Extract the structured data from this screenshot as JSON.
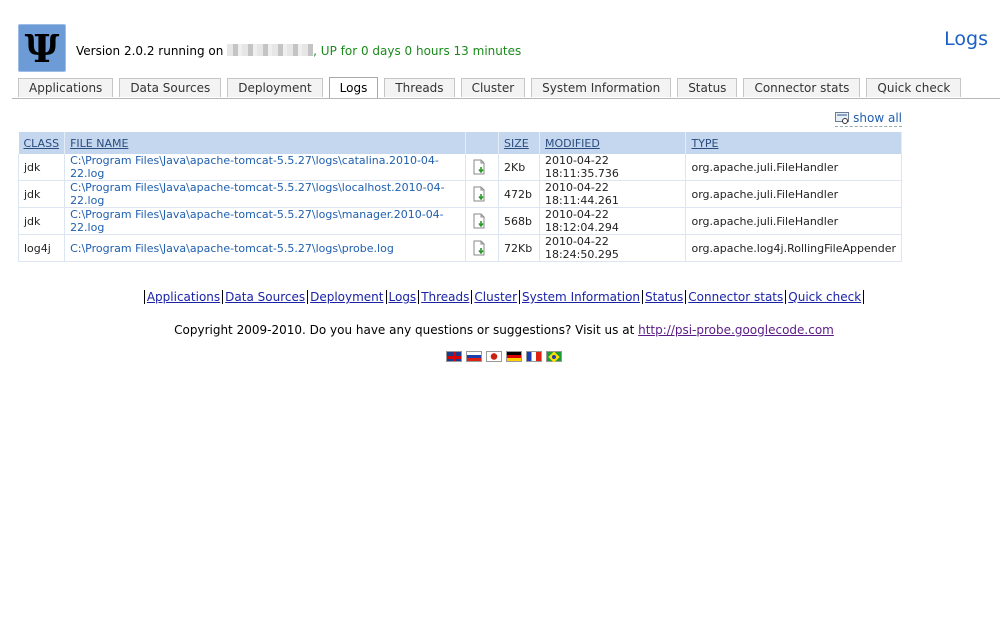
{
  "header": {
    "version_text": "Version 2.0.2 running on ",
    "uptime_text": ", UP for 0 days 0 hours 13 minutes",
    "page_title": "Logs",
    "logo_glyph": "Ψ"
  },
  "tabs": [
    {
      "label": "Applications"
    },
    {
      "label": "Data Sources"
    },
    {
      "label": "Deployment"
    },
    {
      "label": "Logs",
      "active": true
    },
    {
      "label": "Threads"
    },
    {
      "label": "Cluster"
    },
    {
      "label": "System Information"
    },
    {
      "label": "Status"
    },
    {
      "label": "Connector stats"
    },
    {
      "label": "Quick check"
    }
  ],
  "show_all": "show all",
  "table": {
    "columns": [
      "CLASS",
      "FILE NAME",
      "",
      "SIZE",
      "MODIFIED",
      "TYPE"
    ],
    "rows": [
      {
        "class": "jdk",
        "file": "C:\\Program Files\\Java\\apache-tomcat-5.5.27\\logs\\catalina.2010-04-22.log",
        "size": "2Kb",
        "modified": "2010-04-22 18:11:35.736",
        "type": "org.apache.juli.FileHandler"
      },
      {
        "class": "jdk",
        "file": "C:\\Program Files\\Java\\apache-tomcat-5.5.27\\logs\\localhost.2010-04-22.log",
        "size": "472b",
        "modified": "2010-04-22 18:11:44.261",
        "type": "org.apache.juli.FileHandler"
      },
      {
        "class": "jdk",
        "file": "C:\\Program Files\\Java\\apache-tomcat-5.5.27\\logs\\manager.2010-04-22.log",
        "size": "568b",
        "modified": "2010-04-22 18:12:04.294",
        "type": "org.apache.juli.FileHandler"
      },
      {
        "class": "log4j",
        "file": "C:\\Program Files\\Java\\apache-tomcat-5.5.27\\logs\\probe.log",
        "size": "72Kb",
        "modified": "2010-04-22 18:24:50.295",
        "type": "org.apache.log4j.RollingFileAppender"
      }
    ]
  },
  "footer": {
    "links": [
      "Applications",
      "Data Sources",
      "Deployment",
      "Logs",
      "Threads",
      "Cluster",
      "System Information",
      "Status",
      "Connector stats",
      "Quick check"
    ],
    "copyright_text": "Copyright 2009-2010. Do you have any questions or suggestions? Visit us at ",
    "copyright_link": "http://psi-probe.googlecode.com",
    "flags": [
      "gb",
      "ru",
      "jp",
      "de",
      "fr",
      "br"
    ]
  }
}
